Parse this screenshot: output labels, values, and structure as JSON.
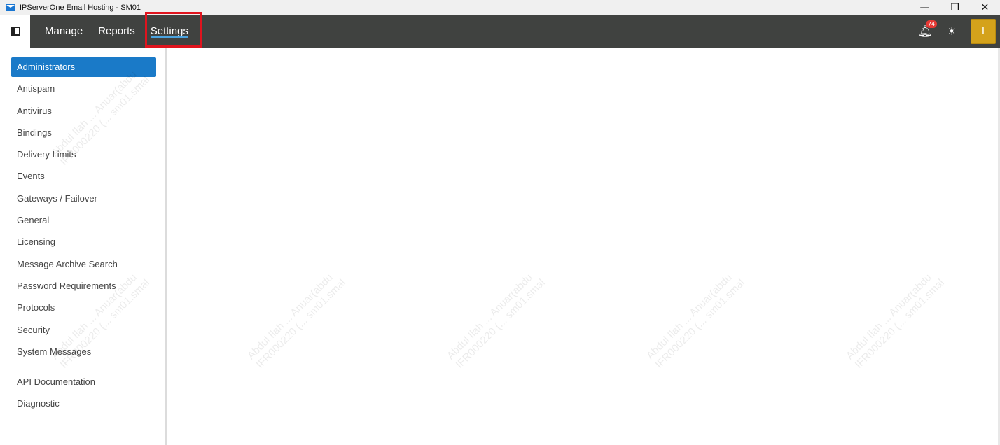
{
  "window": {
    "title": "IPServerOne Email Hosting - SM01",
    "controls": {
      "minimize": "—",
      "restore": "❐",
      "close": "✕"
    }
  },
  "header": {
    "nav": [
      {
        "label": "Manage"
      },
      {
        "label": "Reports"
      },
      {
        "label": "Settings"
      }
    ],
    "active_nav": "Settings",
    "notifications": {
      "count": "74",
      "icon": "bell-icon"
    },
    "theme_icon": "sun-icon",
    "avatar_initial": "I",
    "colors": {
      "header_bg": "#404240",
      "avatar_bg": "#d4a21b",
      "highlight_border": "#e0141e",
      "active_underline": "#4aa3df"
    }
  },
  "sidebar": {
    "items": [
      {
        "label": "Administrators"
      },
      {
        "label": "Antispam"
      },
      {
        "label": "Antivirus"
      },
      {
        "label": "Bindings"
      },
      {
        "label": "Delivery Limits"
      },
      {
        "label": "Events"
      },
      {
        "label": "Gateways / Failover"
      },
      {
        "label": "General"
      },
      {
        "label": "Licensing"
      },
      {
        "label": "Message Archive Search"
      },
      {
        "label": "Password Requirements"
      },
      {
        "label": "Protocols"
      },
      {
        "label": "Security"
      },
      {
        "label": "System Messages"
      }
    ],
    "extra_items": [
      {
        "label": "API Documentation"
      },
      {
        "label": "Diagnostic"
      }
    ],
    "active_item": "Administrators",
    "colors": {
      "active_bg": "#1a7ac8"
    }
  },
  "watermark": {
    "line1": "Abdul Ilah ... Anuar(abdu",
    "line2": "IFR000220 (... sm01.smal"
  }
}
